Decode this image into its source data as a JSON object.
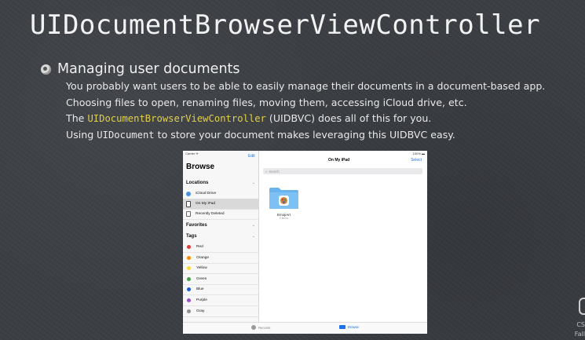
{
  "slide": {
    "title": "UIDocumentBrowserViewController",
    "bullet": "Managing user documents",
    "lines": [
      "You probably want users to be able to easily manage their documents in a document-based app.",
      "Choosing files to open, renaming files, moving them, accessing iCloud drive, etc."
    ],
    "line3": {
      "pre": "The ",
      "code": "UIDocumentBrowserViewController",
      "post": " (UIDBVC) does all of this for you."
    },
    "line4": {
      "pre": "Using ",
      "code": "UIDocument",
      "post": " to store your document makes leveraging this UIDBVC easy."
    },
    "corner_cs": "CS",
    "corner_fall": "Fall"
  },
  "ipad": {
    "status_left": "Carrier ✈",
    "status_right": "100% ▬",
    "edit": "Edit",
    "browse_title": "Browse",
    "sections": {
      "locations": "Locations",
      "favorites": "Favorites",
      "tags": "Tags"
    },
    "locations": [
      {
        "label": "iCloud Drive",
        "icon": "cloud-icon",
        "color": "#4a90e2"
      },
      {
        "label": "On My iPad",
        "icon": "ipad-icon",
        "color": "#444444",
        "selected": true
      },
      {
        "label": "Recently Deleted",
        "icon": "trash-icon",
        "color": "#666666"
      }
    ],
    "tags": [
      {
        "label": "Red",
        "color": "#e53935"
      },
      {
        "label": "Orange",
        "color": "#fb8c00"
      },
      {
        "label": "Yellow",
        "color": "#fdd835"
      },
      {
        "label": "Green",
        "color": "#43a047"
      },
      {
        "label": "Blue",
        "color": "#1e5bd8"
      },
      {
        "label": "Purple",
        "color": "#9c4dcc"
      },
      {
        "label": "Gray",
        "color": "#8e8e8e"
      }
    ],
    "main_title": "On My iPad",
    "select": "Select",
    "search_placeholder": "Search",
    "folder": {
      "name": "EmojiArt",
      "sub": "0 items"
    },
    "tabs": {
      "recents": "Recents",
      "browse": "Browse"
    }
  }
}
